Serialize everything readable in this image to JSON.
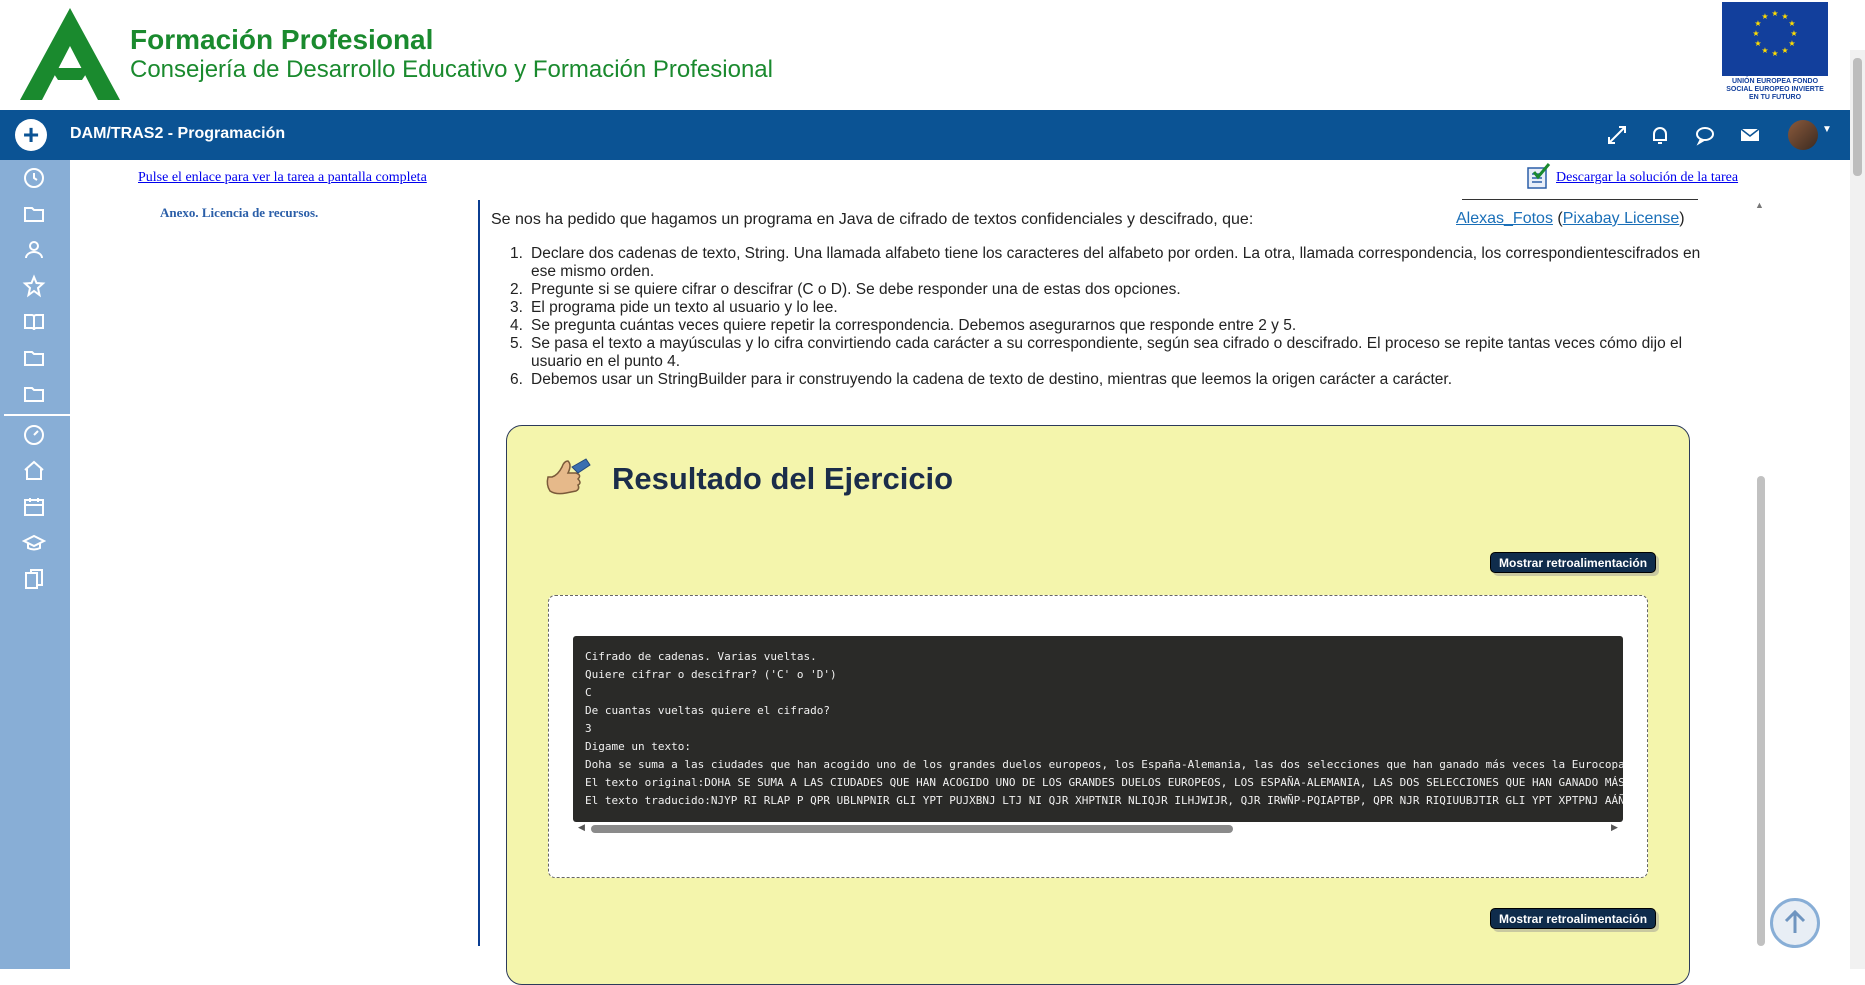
{
  "header": {
    "brand_title": "Formación Profesional",
    "brand_subtitle": "Consejería de Desarrollo Educativo y Formación Profesional",
    "eu_text": "UNIÓN EUROPEA FONDO SOCIAL EUROPEO INVIERTE EN TU FUTURO",
    "brand_color": "#1a8a2e"
  },
  "navbar": {
    "title": "DAM/TRAS2 - Programación",
    "color": "#0b5394",
    "icons": [
      "expand-icon",
      "bell-icon",
      "chat-icon",
      "mail-icon",
      "avatar"
    ]
  },
  "sidebar": {
    "color": "#88aed6",
    "icons": [
      "clock-icon",
      "folder-icon",
      "users-icon",
      "star-icon",
      "book-icon",
      "folder-icon",
      "folder-icon",
      "dashboard-icon",
      "home-icon",
      "calendar-icon",
      "graduation-icon",
      "files-icon"
    ]
  },
  "content": {
    "fullscreen_link": "Pulse el enlace para ver la tarea a pantalla completa",
    "download_link": "Descargar la solución de la tarea",
    "annex": "Anexo. Licencia de recursos.",
    "intro": "Se nos ha pedido que hagamos un programa en Java  de cifrado de textos confidenciales y descifrado, que:",
    "credit_author": "Alexas_Fotos",
    "credit_license": "Pixabay License",
    "steps": [
      "Declare dos cadenas de texto, String. Una llamada alfabeto tiene  los caracteres del alfabeto por orden. La otra, llamada correspondencia, los correspondientescifrados en ese mismo  orden.",
      "Pregunte si se quiere cifrar o descifrar (C o D). Se debe responder una de estas dos opciones.",
      "El programa pide un texto al usuario y lo  lee.",
      "Se pregunta cuántas veces quiere repetir la correspondencia. Debemos asegurarnos que responde entre 2 y 5.",
      "Se pasa el texto a mayúsculas y lo cifra convirtiendo cada carácter a su correspondiente, según sea cifrado o descifrado. El proceso se repite tantas veces cómo dijo el usuario en el punto 4.",
      "Debemos usar un StringBuilder para ir construyendo la cadena de texto de destino, mientras que leemos la origen carácter a carácter."
    ]
  },
  "result": {
    "title": "Resultado del Ejercicio",
    "feedback_button": "Mostrar retroalimentación",
    "background": "#f4f5ac",
    "terminal_lines": [
      "Cifrado de cadenas. Varias vueltas.",
      "Quiere cifrar o descifrar? ('C' o 'D')",
      "C",
      "De cuantas vueltas quiere el cifrado?",
      "3",
      "Digame un texto:",
      "Doha se suma a las ciudades que han acogido uno de los grandes duelos europeos, los España-Alemania, las dos selecciones que han ganado más veces la Eurocopa",
      "El texto original:DOHA SE SUMA A LAS CIUDADES QUE HAN ACOGIDO UNO DE LOS GRANDES DUELOS EUROPEOS, LOS ESPAÑA-ALEMANIA, LAS DOS SELECCIONES QUE HAN GANADO MÁS",
      "El texto traducido:NJYP RI RLAP P QPR UBLNPNIR GLI YPT PUJXBNJ LTJ NI QJR XHPTNIR NLIQJR ILHJWIJR, QJR IRWÑP-PQIAPTBP, QPR NJR RIQIUUBJTIR GLI YPT XPTPNJ AÁÑ"
    ]
  }
}
